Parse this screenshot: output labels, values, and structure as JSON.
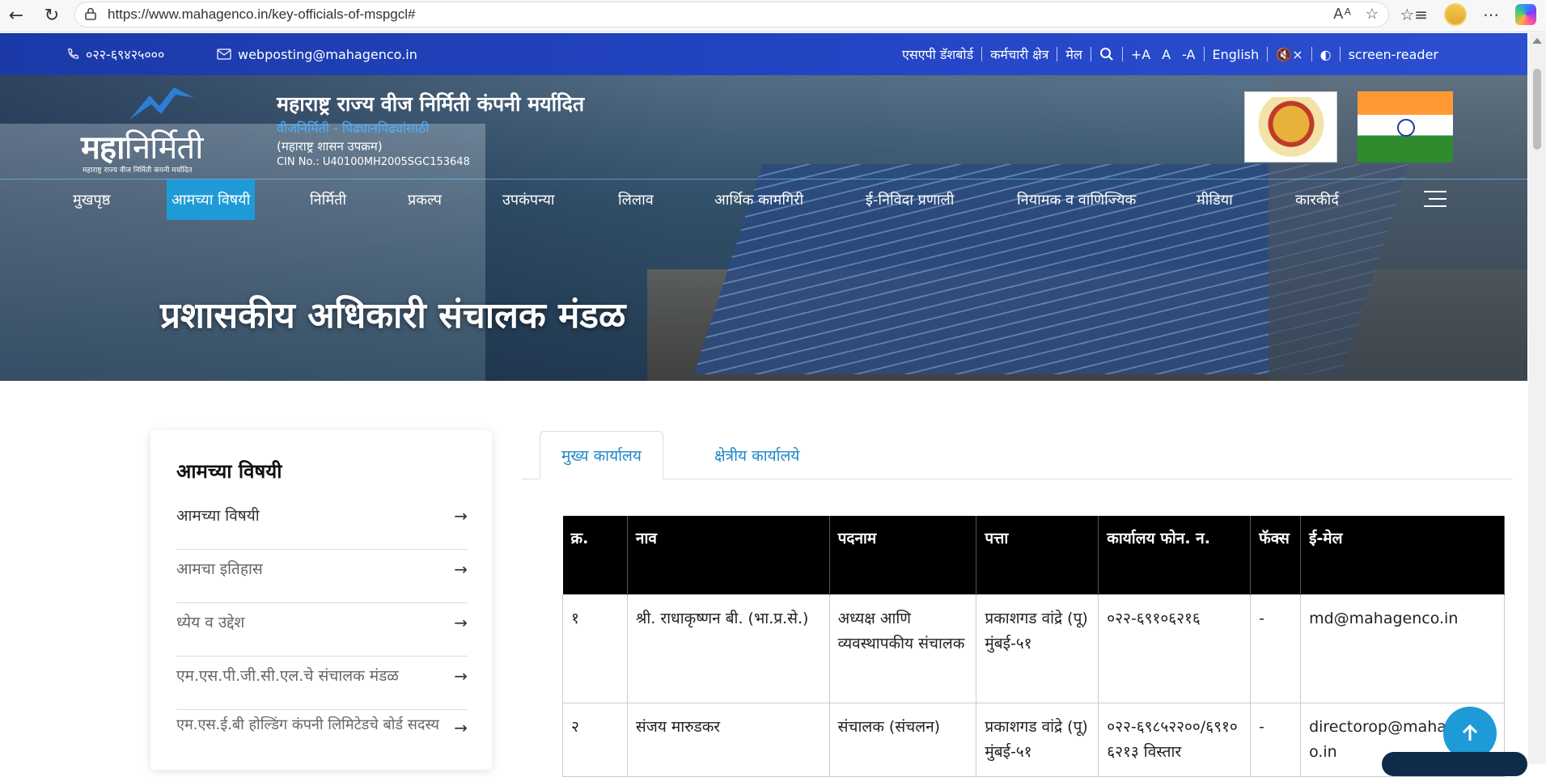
{
  "browser": {
    "url": "https://www.mahagenco.in/key-officials-of-mspgcl#"
  },
  "topstrip": {
    "phone": "०२२-६९४२५०००",
    "email": "webposting@mahagenco.in",
    "links": [
      "एसएपी डॅशबोर्ड",
      "कर्मचारी क्षेत्र",
      "मेल"
    ],
    "font_plus": "+A",
    "font_normal": "A",
    "font_minus": "-A",
    "language": "English",
    "screen_reader": "screen-reader"
  },
  "header": {
    "logo_bold": "महा",
    "logo_light": "निर्मिती",
    "logo_sub": "महाराष्ट्र राज्य वीज निर्मिती कंपनी मर्यादित",
    "org_name": "महाराष्ट्र राज्य वीज निर्मिती कंपनी मर्यादित",
    "tagline": "वीजनिर्मिती - पिढ्यानपिढ्यांसाठी",
    "gov": "(महाराष्ट्र शासन उपक्रम)",
    "cin": "CIN No.: U40100MH2005SGC153648"
  },
  "nav": {
    "items": [
      "मुखपृष्ठ",
      "आमच्या विषयी",
      "निर्मिती",
      "प्रकल्प",
      "उपकंपन्या",
      "लिलाव",
      "आर्थिक कामगिरी",
      "ई-निविदा प्रणाली",
      "नियामक व वाणिज्यिक",
      "मीडिया",
      "कारकीर्द"
    ],
    "active_index": 1
  },
  "page": {
    "heading": "प्रशासकीय अधिकारी संचालक मंडळ"
  },
  "sidebar": {
    "title": "आमच्या विषयी",
    "items": [
      "आमच्या विषयी",
      "आमचा इतिहास",
      "ध्येय व उद्देश",
      "एम.एस.पी.जी.सी.एल.चे संचालक मंडळ",
      "एम.एस.ई.बी होल्डिंग कंपनी लिमिटेडचे बोर्ड सदस्य"
    ]
  },
  "tabs": {
    "active": "मुख्य कार्यालय",
    "other": "क्षेत्रीय कार्यालये"
  },
  "table": {
    "headers": [
      "क्र.",
      "नाव",
      "पदनाम",
      "पत्ता",
      "कार्यालय फोन. न.",
      "फॅक्स",
      "ई-मेल"
    ],
    "rows": [
      [
        "१",
        "श्री. राधाकृष्णन बी. (भा.प्र.से.)",
        "अध्यक्ष आणि व्यवस्थापकीय संचालक",
        "प्रकाशगड वांद्रे (पू) मुंबई-५१",
        "०२२-६९१०६२१६",
        "-",
        "md@mahagenco.in"
      ],
      [
        "२",
        "संजय मारुडकर",
        "संचालक (संचलन)",
        "प्रकाशगड वांद्रे (पू) मुंबई-५१",
        "०२२-६९८५२२००/६९१०६२१३ विस्तार",
        "-",
        "directorop@mahagenco.in"
      ]
    ]
  }
}
